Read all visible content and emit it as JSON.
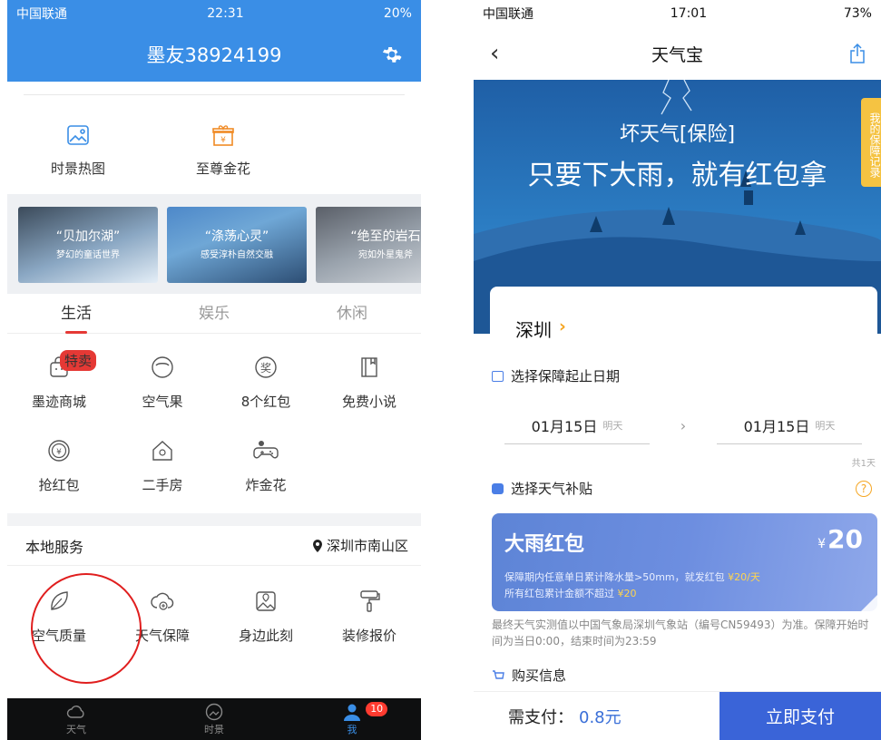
{
  "left": {
    "status": {
      "carrier": "中国联通",
      "time": "22:31",
      "battery": "20%"
    },
    "header": {
      "title": "墨友38924199"
    },
    "top_icons": [
      {
        "label": "时景热图",
        "icon": "image-icon"
      },
      {
        "label": "至尊金花",
        "icon": "gift-icon"
      }
    ],
    "banners": [
      {
        "title": "“贝加尔湖”",
        "subtitle": "梦幻的童话世界"
      },
      {
        "title": "“涤荡心灵”",
        "subtitle": "感受淳朴自然交融"
      },
      {
        "title": "“绝至的岩石",
        "subtitle": "宛如外星鬼斧"
      }
    ],
    "tabs": [
      "生活",
      "娱乐",
      "休闲"
    ],
    "grid_items": [
      {
        "label": "墨迹商城",
        "icon": "shop-bag-icon",
        "badge": "特卖"
      },
      {
        "label": "空气果",
        "icon": "air-fruit-icon"
      },
      {
        "label": "8个红包",
        "icon": "reward-icon"
      },
      {
        "label": "免费小说",
        "icon": "book-icon"
      },
      {
        "label": "抢红包",
        "icon": "coin-icon"
      },
      {
        "label": "二手房",
        "icon": "house-icon"
      },
      {
        "label": "炸金花",
        "icon": "gamepad-icon"
      }
    ],
    "local": {
      "title": "本地服务",
      "location": "深圳市南山区",
      "items": [
        {
          "label": "空气质量",
          "icon": "leaf-icon"
        },
        {
          "label": "天气保障",
          "icon": "cloud-shield-icon"
        },
        {
          "label": "身边此刻",
          "icon": "photo-pin-icon"
        },
        {
          "label": "装修报价",
          "icon": "paint-roller-icon"
        }
      ]
    },
    "tabbar": [
      {
        "label": "天气",
        "icon": "cloud-icon"
      },
      {
        "label": "时景",
        "icon": "scene-icon"
      },
      {
        "label": "我",
        "icon": "user-icon",
        "badge": "10"
      }
    ]
  },
  "right": {
    "status": {
      "carrier": "中国联通",
      "time": "17:01",
      "battery": "73%"
    },
    "nav": {
      "title": "天气宝",
      "back": "‹"
    },
    "hero": {
      "line1": "坏天气[保险]",
      "line2": "只要下大雨，就有红包拿",
      "side_tab": "我的保障记录"
    },
    "city": "深圳",
    "section_date": "选择保障起止日期",
    "start_date": {
      "date": "01月15日",
      "tag": "明天"
    },
    "end_date": {
      "date": "01月15日",
      "tag": "明天"
    },
    "days": "共1天",
    "section_subsidy": "选择天气补贴",
    "redpack": {
      "title": "大雨红包",
      "currency": "¥",
      "price": "20",
      "line1_prefix": "保障期内任意单日累计降水量>50mm，就发红包",
      "line1_amount": "¥20/天",
      "line2_prefix": "所有红包累计金额不超过",
      "line2_amount": "¥20"
    },
    "note": "最终天气实测值以中国气象局深圳气象站（编号CN59493）为准。保障开始时间为当日0:00，结束时间为23:59",
    "section_buy": "购买信息",
    "pay": {
      "need_label": "需支付：",
      "amount": "0.8元",
      "button": "立即支付"
    }
  },
  "colors": {
    "header_blue": "#3a8ee6",
    "accent_red": "#e53935",
    "pay_blue": "#3a64d8",
    "gold": "#f5a623"
  }
}
